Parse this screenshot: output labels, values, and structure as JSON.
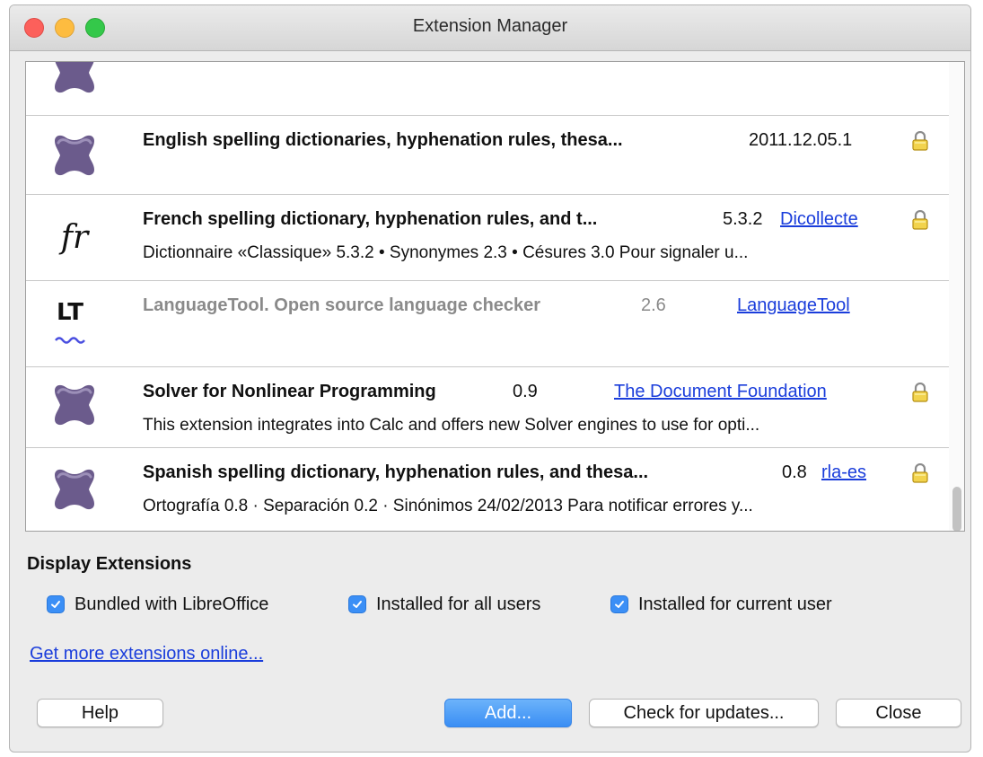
{
  "window": {
    "title": "Extension Manager"
  },
  "extensions": [
    {
      "title": "",
      "version": "",
      "publisher": "",
      "description": "",
      "icon": "puzzle-icon",
      "locked": false
    },
    {
      "title": "English spelling dictionaries, hyphenation rules, thesa...",
      "version": "2011.12.05.1",
      "publisher": "",
      "description": "",
      "icon": "puzzle-icon",
      "locked": true
    },
    {
      "title": "French spelling dictionary, hyphenation rules, and t...",
      "version": "5.3.2",
      "publisher": "Dicollecte",
      "description": "Dictionnaire «Classique» 5.3.2 • Synonymes 2.3 • Césures 3.0  Pour signaler u...",
      "icon": "fr-icon",
      "icon_text": "fr",
      "locked": true
    },
    {
      "title": "LanguageTool. Open source language checker",
      "version": "2.6",
      "publisher": "LanguageTool",
      "description": "",
      "icon": "languagetool-icon",
      "icon_text": "LT",
      "locked": false,
      "disabled": true
    },
    {
      "title": "Solver for Nonlinear Programming",
      "version": "0.9",
      "publisher": "The Document Foundation",
      "description": "This extension integrates into Calc and offers new Solver engines to use for opti...",
      "icon": "puzzle-icon",
      "locked": true
    },
    {
      "title": "Spanish spelling dictionary, hyphenation rules, and thesa...",
      "version": "0.8",
      "publisher": "rla-es",
      "description": "Ortografía 0.8 · Separación 0.2 · Sinónimos 24/02/2013  Para notificar errores y...",
      "icon": "puzzle-icon",
      "locked": true
    }
  ],
  "display": {
    "title": "Display Extensions",
    "bundled": "Bundled with LibreOffice",
    "all_users": "Installed for all users",
    "current_user": "Installed for current user"
  },
  "get_more": "Get more extensions online...",
  "buttons": {
    "help": "Help",
    "add": "Add...",
    "check_updates": "Check for updates...",
    "close": "Close"
  },
  "colors": {
    "link": "#1a3ddb",
    "puzzle": "#6b5b8c",
    "checkbox": "#3b8ff6"
  }
}
